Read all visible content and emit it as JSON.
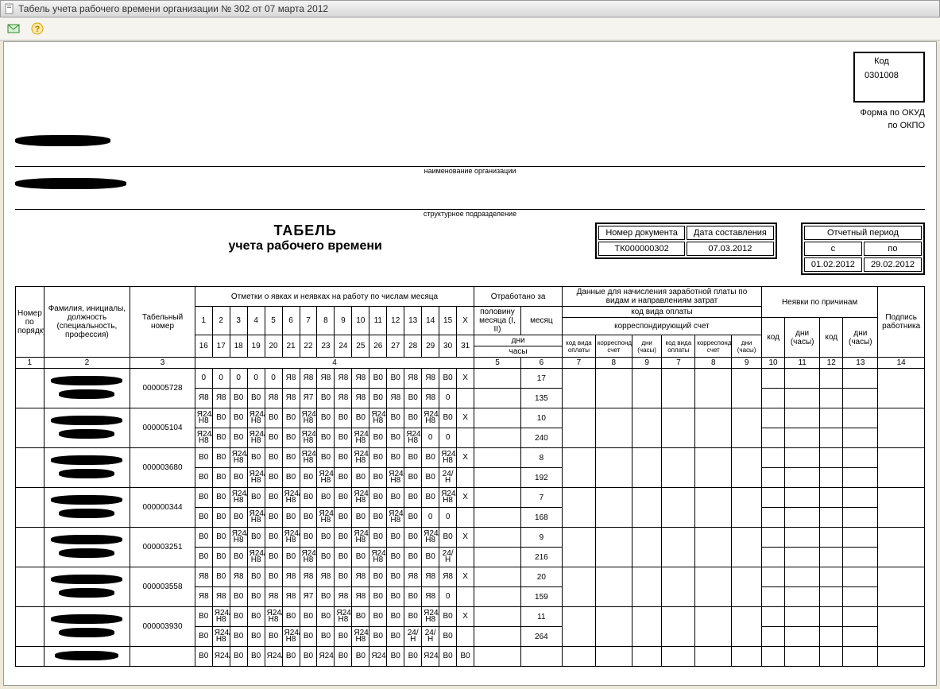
{
  "window_title": "Табель учета рабочего времени организации № 302 от 07 марта 2012",
  "header": {
    "code_label": "Код",
    "okud_label": "Форма по ОКУД",
    "okud_value": "0301008",
    "okpo_label": "по ОКПО",
    "okpo_value": "",
    "org_caption": "наименование организации",
    "dept_caption": "структурное подразделение",
    "doc_num_label": "Номер документа",
    "doc_date_label": "Дата составления",
    "doc_num": "ТК000000302",
    "doc_date": "07.03.2012",
    "period_label": "Отчетный период",
    "period_from_label": "с",
    "period_to_label": "по",
    "period_from": "01.02.2012",
    "period_to": "29.02.2012",
    "title1": "ТАБЕЛЬ",
    "title2": "учета  рабочего времени"
  },
  "cols": {
    "num": "Номер по порядку",
    "name": "Фамилия, инициалы, должность (специальность, профессия)",
    "tab": "Табельный номер",
    "marks": "Отметки о явках и неявках на работу по числам месяца",
    "worked": "Отработано за",
    "half": "половину месяца (I, II)",
    "month": "месяц",
    "days": "дни",
    "hours": "часы",
    "payroll": "Данные для начисления заработной платы по видам и направлениям затрат",
    "paycode": "код вида оплаты",
    "corr": "корреспондирующий счет",
    "code": "код",
    "dayshours": "дни (часы)",
    "absence": "Неявки по причинам",
    "sign": "Подпись работника",
    "d1_15": [
      "1",
      "2",
      "3",
      "4",
      "5",
      "6",
      "7",
      "8",
      "9",
      "10",
      "11",
      "12",
      "13",
      "14",
      "15",
      "X"
    ],
    "d16_31": [
      "16",
      "17",
      "18",
      "19",
      "20",
      "21",
      "22",
      "23",
      "24",
      "25",
      "26",
      "27",
      "28",
      "29",
      "30",
      "31"
    ],
    "colnums": [
      "1",
      "2",
      "3",
      "4",
      "5",
      "6",
      "7",
      "8",
      "9",
      "7",
      "8",
      "9",
      "10",
      "11",
      "12",
      "13",
      "14"
    ]
  },
  "rows": [
    {
      "tab": "000005728",
      "r1": [
        "0",
        "0",
        "0",
        "0",
        "0",
        "Я8",
        "Я8",
        "Я8",
        "Я8",
        "Я8",
        "В0",
        "В0",
        "Я8",
        "Я8",
        "В0",
        "X"
      ],
      "r2": [
        "Я8",
        "Я8",
        "В0",
        "В0",
        "Я8",
        "Я8",
        "Я7",
        "В0",
        "Я8",
        "Я8",
        "В0",
        "Я8",
        "В0",
        "Я8",
        "0",
        ""
      ],
      "days": "17",
      "hours": "135"
    },
    {
      "tab": "000005104",
      "r1": [
        "Я24/Н8",
        "В0",
        "В0",
        "Я24/Н8",
        "В0",
        "В0",
        "Я24/Н8",
        "В0",
        "В0",
        "В0",
        "Я24/Н8",
        "В0",
        "В0",
        "Я24/Н8",
        "В0",
        "X"
      ],
      "r2": [
        "Я24/Н8",
        "В0",
        "В0",
        "Я24/Н8",
        "В0",
        "В0",
        "Я24/Н8",
        "В0",
        "В0",
        "Я24/Н8",
        "В0",
        "В0",
        "Я24/Н8",
        "0",
        "0",
        ""
      ],
      "days": "10",
      "hours": "240"
    },
    {
      "tab": "000003680",
      "r1": [
        "В0",
        "В0",
        "Я24/Н8",
        "В0",
        "В0",
        "В0",
        "Я24/Н8",
        "В0",
        "В0",
        "Я24/Н8",
        "В0",
        "В0",
        "В0",
        "В0",
        "Я24/Н8",
        "X"
      ],
      "r2": [
        "В0",
        "В0",
        "В0",
        "Я24/Н8",
        "В0",
        "В0",
        "В0",
        "Я24/Н8",
        "В0",
        "В0",
        "В0",
        "Я24/Н8",
        "В0",
        "В0",
        "24/Н",
        ""
      ],
      "days": "8",
      "hours": "192"
    },
    {
      "tab": "000000344",
      "r1": [
        "В0",
        "В0",
        "Я24/Н8",
        "В0",
        "В0",
        "Я24/Н8",
        "В0",
        "В0",
        "В0",
        "Я24/Н8",
        "В0",
        "В0",
        "В0",
        "В0",
        "Я24/Н8",
        "X"
      ],
      "r2": [
        "В0",
        "В0",
        "В0",
        "Я24/Н8",
        "В0",
        "В0",
        "В0",
        "Я24/Н8",
        "В0",
        "В0",
        "В0",
        "Я24/Н8",
        "В0",
        "0",
        "0",
        ""
      ],
      "days": "7",
      "hours": "168"
    },
    {
      "tab": "000003251",
      "r1": [
        "В0",
        "В0",
        "Я24/Н8",
        "В0",
        "В0",
        "Я24/Н8",
        "В0",
        "В0",
        "В0",
        "Я24/Н8",
        "В0",
        "В0",
        "В0",
        "Я24/Н8",
        "В0",
        "X"
      ],
      "r2": [
        "В0",
        "В0",
        "В0",
        "Я24/Н8",
        "В0",
        "В0",
        "Я24/Н8",
        "В0",
        "В0",
        "В0",
        "Я24/Н8",
        "В0",
        "В0",
        "В0",
        "24/Н",
        ""
      ],
      "days": "9",
      "hours": "216"
    },
    {
      "tab": "000003558",
      "r1": [
        "Я8",
        "В0",
        "Я8",
        "В0",
        "В0",
        "Я8",
        "Я8",
        "Я8",
        "В0",
        "Я8",
        "В0",
        "В0",
        "Я8",
        "Я8",
        "Я8",
        "X"
      ],
      "r2": [
        "Я8",
        "Я8",
        "В0",
        "В0",
        "Я8",
        "Я8",
        "Я7",
        "В0",
        "Я8",
        "Я8",
        "В0",
        "В0",
        "В0",
        "Я8",
        "0",
        ""
      ],
      "days": "20",
      "hours": "159"
    },
    {
      "tab": "000003930",
      "r1": [
        "В0",
        "Я24/Н8",
        "В0",
        "В0",
        "Я24/Н8",
        "В0",
        "В0",
        "В0",
        "Я24/Н8",
        "В0",
        "В0",
        "В0",
        "В0",
        "Я24/Н8",
        "В0",
        "X"
      ],
      "r2": [
        "В0",
        "Я24/Н8",
        "В0",
        "В0",
        "В0",
        "Я24/Н8",
        "В0",
        "В0",
        "В0",
        "Я24/Н8",
        "В0",
        "В0",
        "24/Н",
        "24/Н",
        "В0",
        ""
      ],
      "days": "11",
      "hours": "264"
    }
  ]
}
